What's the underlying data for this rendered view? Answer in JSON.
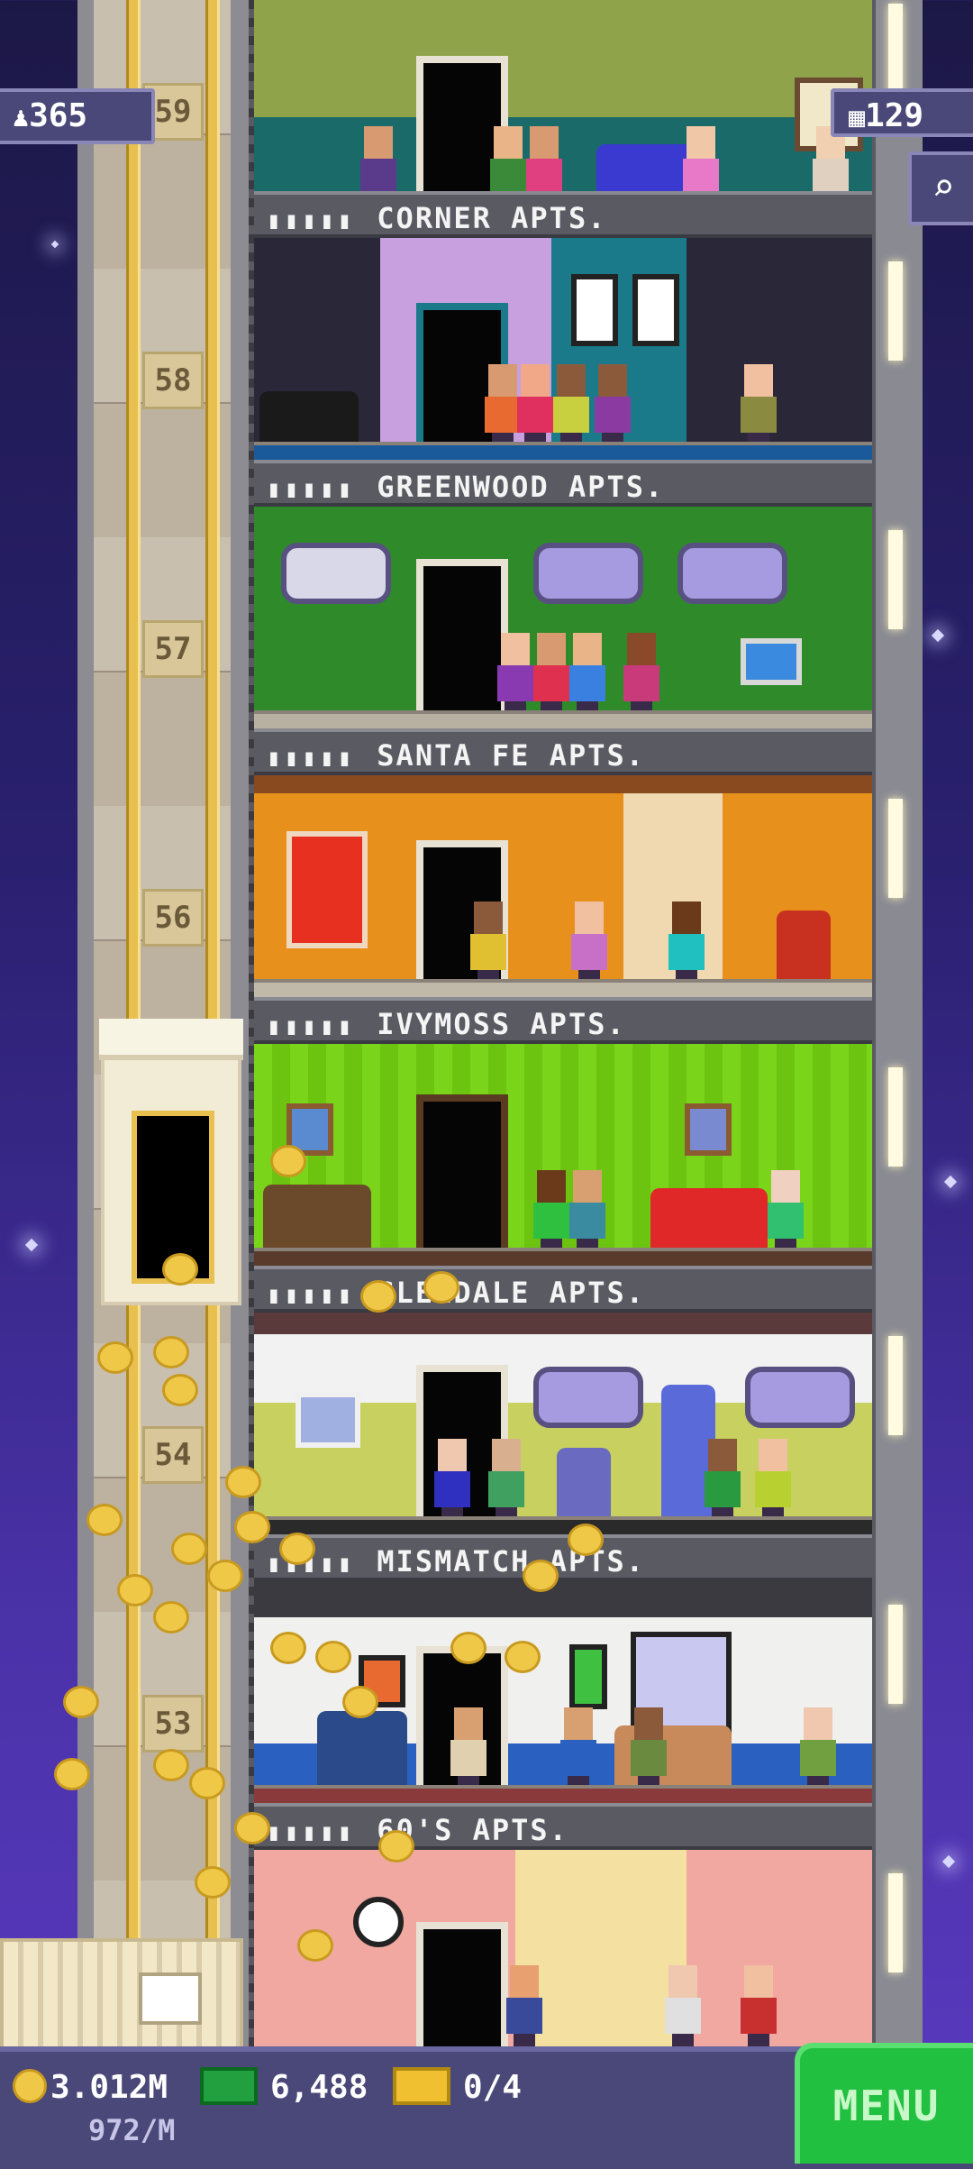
{
  "top": {
    "population": "365",
    "floor_count": "129",
    "population_icon": "person-icon",
    "floors_icon": "building-icon",
    "search_icon": "magnifier-icon"
  },
  "elevator_floor_numbers": [
    "59",
    "58",
    "57",
    "56",
    "54",
    "53"
  ],
  "floors": [
    {
      "name": "CORNER APTS.",
      "color": "#8fa44a"
    },
    {
      "name": "GREENWOOD APTS.",
      "color": "#2a2838"
    },
    {
      "name": "SANTA FE APTS.",
      "color": "#2f8a2a"
    },
    {
      "name": "IVYMOSS APTS.",
      "color": "#e8901c"
    },
    {
      "name": "GLENDALE APTS.",
      "color": "#7ad41a"
    },
    {
      "name": "MISMATCH APTS.",
      "color": "#c8d060"
    },
    {
      "name": "60'S APTS.",
      "color": "#f0f0ee"
    }
  ],
  "rating_pips": "▮▮▮▮▮",
  "hud": {
    "coins": "3.012M",
    "coins_rate": "972/M",
    "bux": "6,488",
    "tickets": "0/4",
    "menu_label": "MENU"
  }
}
